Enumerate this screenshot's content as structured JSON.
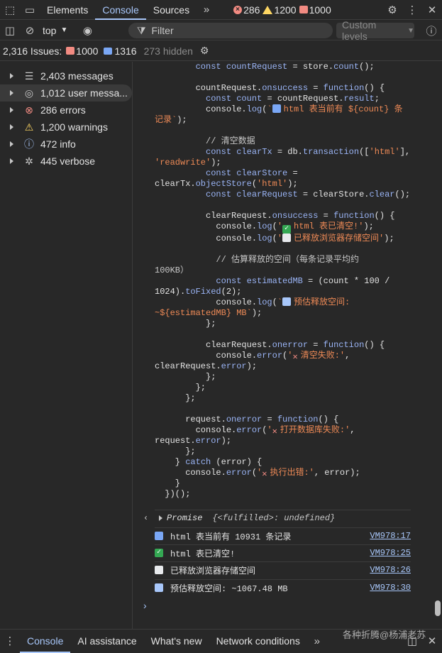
{
  "toolbar": {
    "tabs": [
      "Elements",
      "Console",
      "Sources"
    ],
    "active_tab": "Console",
    "error_count": "286",
    "warning_count": "1200",
    "issue_count": "1000"
  },
  "console_toolbar": {
    "context": "top",
    "filter_placeholder": "Filter",
    "levels": "Custom levels"
  },
  "issues": {
    "label": "2,316 Issues:",
    "errors": "1000",
    "info": "1316",
    "hidden": "273 hidden"
  },
  "sidebar": {
    "items": [
      {
        "label": "2,403 messages",
        "icon": "list-icon"
      },
      {
        "label": "1,012 user messa...",
        "icon": "user-icon"
      },
      {
        "label": "286 errors",
        "icon": "error-icon"
      },
      {
        "label": "1,200 warnings",
        "icon": "warning-icon"
      },
      {
        "label": "472 info",
        "icon": "info-icon"
      },
      {
        "label": "445 verbose",
        "icon": "bug-icon"
      }
    ]
  },
  "logs": [
    {
      "text": "html 表当前有 10931 条记录",
      "src": "VM978:17",
      "icon": "chart-icon"
    },
    {
      "text": "html 表已清空!",
      "src": "VM978:25",
      "icon": "check-icon"
    },
    {
      "text": "已释放浏览器存储空间",
      "src": "VM978:26",
      "icon": "disk-icon"
    },
    {
      "text": "预估释放空间: ~1067.48 MB",
      "src": "VM978:30",
      "icon": "chart-down-icon"
    }
  ],
  "promise": {
    "label": "Promise",
    "state": "{<fulfilled>: undefined}"
  },
  "bottom_tabs": [
    "Console",
    "AI assistance",
    "What's new",
    "Network conditions"
  ],
  "watermark": "各种折腾@杨浦老苏",
  "colors": {
    "accent": "#a8c7fa",
    "error": "#f28b82",
    "warning": "#fdd663",
    "string": "#ee8a56"
  }
}
